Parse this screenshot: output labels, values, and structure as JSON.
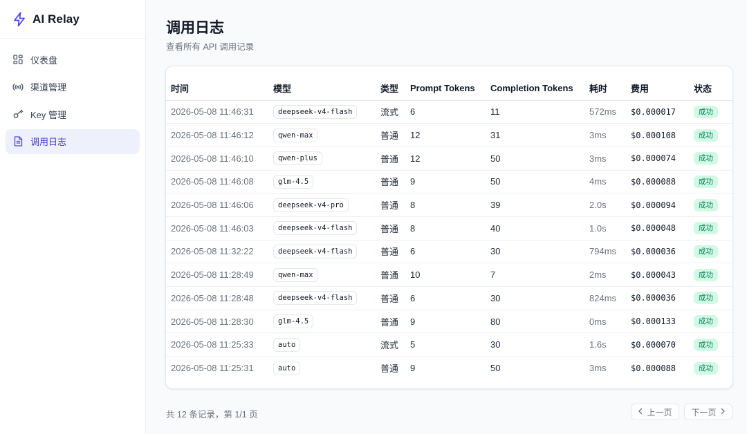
{
  "app": {
    "name": "AI Relay",
    "brand_color": "#4f46e5"
  },
  "sidebar": {
    "items": [
      {
        "label": "仪表盘",
        "icon": "dashboard-grid-icon",
        "active": false
      },
      {
        "label": "渠道管理",
        "icon": "broadcast-icon",
        "active": false
      },
      {
        "label": "Key 管理",
        "icon": "key-icon",
        "active": false
      },
      {
        "label": "调用日志",
        "icon": "document-icon",
        "active": true
      }
    ]
  },
  "page": {
    "title": "调用日志",
    "subtitle": "查看所有 API 调用记录"
  },
  "table": {
    "columns": [
      "时间",
      "模型",
      "类型",
      "Prompt Tokens",
      "Completion Tokens",
      "耗时",
      "费用",
      "状态"
    ],
    "rows": [
      {
        "time": "2026-05-08 11:46:31",
        "model": "deepseek-v4-flash",
        "type": "流式",
        "prompt": "6",
        "completion": "11",
        "duration": "572ms",
        "cost": "$0.000017",
        "status": "成功"
      },
      {
        "time": "2026-05-08 11:46:12",
        "model": "qwen-max",
        "type": "普通",
        "prompt": "12",
        "completion": "31",
        "duration": "3ms",
        "cost": "$0.000108",
        "status": "成功"
      },
      {
        "time": "2026-05-08 11:46:10",
        "model": "qwen-plus",
        "type": "普通",
        "prompt": "12",
        "completion": "50",
        "duration": "3ms",
        "cost": "$0.000074",
        "status": "成功"
      },
      {
        "time": "2026-05-08 11:46:08",
        "model": "glm-4.5",
        "type": "普通",
        "prompt": "9",
        "completion": "50",
        "duration": "4ms",
        "cost": "$0.000088",
        "status": "成功"
      },
      {
        "time": "2026-05-08 11:46:06",
        "model": "deepseek-v4-pro",
        "type": "普通",
        "prompt": "8",
        "completion": "39",
        "duration": "2.0s",
        "cost": "$0.000094",
        "status": "成功"
      },
      {
        "time": "2026-05-08 11:46:03",
        "model": "deepseek-v4-flash",
        "type": "普通",
        "prompt": "8",
        "completion": "40",
        "duration": "1.0s",
        "cost": "$0.000048",
        "status": "成功"
      },
      {
        "time": "2026-05-08 11:32:22",
        "model": "deepseek-v4-flash",
        "type": "普通",
        "prompt": "6",
        "completion": "30",
        "duration": "794ms",
        "cost": "$0.000036",
        "status": "成功"
      },
      {
        "time": "2026-05-08 11:28:49",
        "model": "qwen-max",
        "type": "普通",
        "prompt": "10",
        "completion": "7",
        "duration": "2ms",
        "cost": "$0.000043",
        "status": "成功"
      },
      {
        "time": "2026-05-08 11:28:48",
        "model": "deepseek-v4-flash",
        "type": "普通",
        "prompt": "6",
        "completion": "30",
        "duration": "824ms",
        "cost": "$0.000036",
        "status": "成功"
      },
      {
        "time": "2026-05-08 11:28:30",
        "model": "glm-4.5",
        "type": "普通",
        "prompt": "9",
        "completion": "80",
        "duration": "0ms",
        "cost": "$0.000133",
        "status": "成功"
      },
      {
        "time": "2026-05-08 11:25:33",
        "model": "auto",
        "type": "流式",
        "prompt": "5",
        "completion": "30",
        "duration": "1.6s",
        "cost": "$0.000070",
        "status": "成功"
      },
      {
        "time": "2026-05-08 11:25:31",
        "model": "auto",
        "type": "普通",
        "prompt": "9",
        "completion": "50",
        "duration": "3ms",
        "cost": "$0.000088",
        "status": "成功"
      }
    ]
  },
  "footer": {
    "summary": "共 12 条记录，第 1/1 页",
    "prev_label": "上一页",
    "next_label": "下一页"
  },
  "colors": {
    "status_success_bg": "#d1fae5",
    "status_success_text": "#047857",
    "active_nav_bg": "#eef0fc"
  }
}
